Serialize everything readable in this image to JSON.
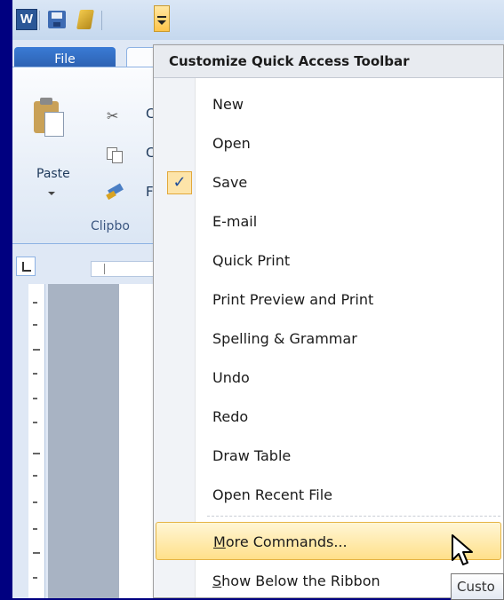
{
  "qat": {
    "app_icon_letter": "W",
    "icons": [
      "word-icon",
      "save-icon",
      "undo-icon",
      "customize-qat-icon"
    ]
  },
  "tabs": {
    "file": "File",
    "home": ""
  },
  "ribbon": {
    "paste_label": "Paste",
    "cut_partial": "C",
    "copy_partial": "C",
    "format_partial": "F",
    "group_label": "Clipbo"
  },
  "menu": {
    "header": "Customize Quick Access Toolbar",
    "items": [
      {
        "label": "New",
        "checked": false
      },
      {
        "label": "Open",
        "checked": false
      },
      {
        "label": "Save",
        "checked": true
      },
      {
        "label": "E-mail",
        "checked": false
      },
      {
        "label": "Quick Print",
        "checked": false
      },
      {
        "label": "Print Preview and Print",
        "checked": false
      },
      {
        "label": "Spelling & Grammar",
        "checked": false
      },
      {
        "label": "Undo",
        "checked": false
      },
      {
        "label": "Redo",
        "checked": false
      },
      {
        "label": "Draw Table",
        "checked": false
      },
      {
        "label": "Open Recent File",
        "checked": false
      }
    ],
    "more_commands": {
      "mnemonic": "M",
      "rest": "ore Commands..."
    },
    "show_below": {
      "mnemonic": "S",
      "rest": "how Below the Ribbon"
    },
    "check_glyph": "✓"
  },
  "tooltip": {
    "text": "Custo"
  },
  "colors": {
    "frame": "#000080",
    "file_tab": "#2a5caa",
    "highlight": "#ffe08a"
  }
}
